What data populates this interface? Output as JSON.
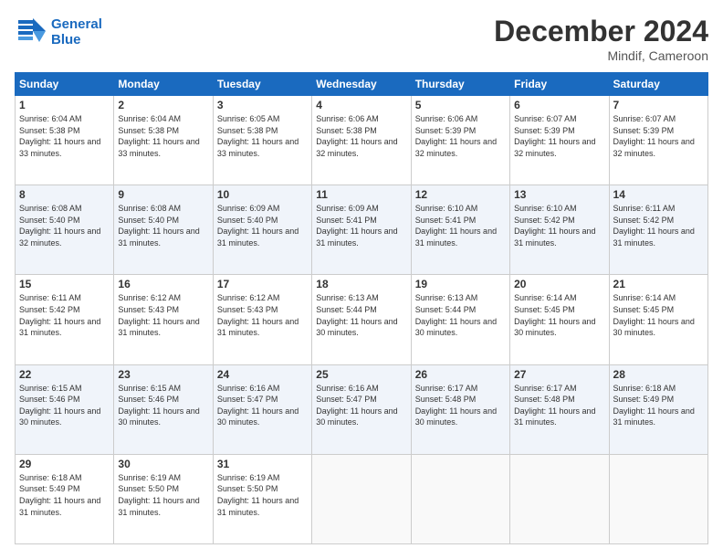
{
  "header": {
    "logo_line1": "General",
    "logo_line2": "Blue",
    "month_title": "December 2024",
    "location": "Mindif, Cameroon"
  },
  "weekdays": [
    "Sunday",
    "Monday",
    "Tuesday",
    "Wednesday",
    "Thursday",
    "Friday",
    "Saturday"
  ],
  "weeks": [
    [
      {
        "day": "1",
        "sunrise": "6:04 AM",
        "sunset": "5:38 PM",
        "daylight": "11 hours and 33 minutes."
      },
      {
        "day": "2",
        "sunrise": "6:04 AM",
        "sunset": "5:38 PM",
        "daylight": "11 hours and 33 minutes."
      },
      {
        "day": "3",
        "sunrise": "6:05 AM",
        "sunset": "5:38 PM",
        "daylight": "11 hours and 33 minutes."
      },
      {
        "day": "4",
        "sunrise": "6:06 AM",
        "sunset": "5:38 PM",
        "daylight": "11 hours and 32 minutes."
      },
      {
        "day": "5",
        "sunrise": "6:06 AM",
        "sunset": "5:39 PM",
        "daylight": "11 hours and 32 minutes."
      },
      {
        "day": "6",
        "sunrise": "6:07 AM",
        "sunset": "5:39 PM",
        "daylight": "11 hours and 32 minutes."
      },
      {
        "day": "7",
        "sunrise": "6:07 AM",
        "sunset": "5:39 PM",
        "daylight": "11 hours and 32 minutes."
      }
    ],
    [
      {
        "day": "8",
        "sunrise": "6:08 AM",
        "sunset": "5:40 PM",
        "daylight": "11 hours and 32 minutes."
      },
      {
        "day": "9",
        "sunrise": "6:08 AM",
        "sunset": "5:40 PM",
        "daylight": "11 hours and 31 minutes."
      },
      {
        "day": "10",
        "sunrise": "6:09 AM",
        "sunset": "5:40 PM",
        "daylight": "11 hours and 31 minutes."
      },
      {
        "day": "11",
        "sunrise": "6:09 AM",
        "sunset": "5:41 PM",
        "daylight": "11 hours and 31 minutes."
      },
      {
        "day": "12",
        "sunrise": "6:10 AM",
        "sunset": "5:41 PM",
        "daylight": "11 hours and 31 minutes."
      },
      {
        "day": "13",
        "sunrise": "6:10 AM",
        "sunset": "5:42 PM",
        "daylight": "11 hours and 31 minutes."
      },
      {
        "day": "14",
        "sunrise": "6:11 AM",
        "sunset": "5:42 PM",
        "daylight": "11 hours and 31 minutes."
      }
    ],
    [
      {
        "day": "15",
        "sunrise": "6:11 AM",
        "sunset": "5:42 PM",
        "daylight": "11 hours and 31 minutes."
      },
      {
        "day": "16",
        "sunrise": "6:12 AM",
        "sunset": "5:43 PM",
        "daylight": "11 hours and 31 minutes."
      },
      {
        "day": "17",
        "sunrise": "6:12 AM",
        "sunset": "5:43 PM",
        "daylight": "11 hours and 31 minutes."
      },
      {
        "day": "18",
        "sunrise": "6:13 AM",
        "sunset": "5:44 PM",
        "daylight": "11 hours and 30 minutes."
      },
      {
        "day": "19",
        "sunrise": "6:13 AM",
        "sunset": "5:44 PM",
        "daylight": "11 hours and 30 minutes."
      },
      {
        "day": "20",
        "sunrise": "6:14 AM",
        "sunset": "5:45 PM",
        "daylight": "11 hours and 30 minutes."
      },
      {
        "day": "21",
        "sunrise": "6:14 AM",
        "sunset": "5:45 PM",
        "daylight": "11 hours and 30 minutes."
      }
    ],
    [
      {
        "day": "22",
        "sunrise": "6:15 AM",
        "sunset": "5:46 PM",
        "daylight": "11 hours and 30 minutes."
      },
      {
        "day": "23",
        "sunrise": "6:15 AM",
        "sunset": "5:46 PM",
        "daylight": "11 hours and 30 minutes."
      },
      {
        "day": "24",
        "sunrise": "6:16 AM",
        "sunset": "5:47 PM",
        "daylight": "11 hours and 30 minutes."
      },
      {
        "day": "25",
        "sunrise": "6:16 AM",
        "sunset": "5:47 PM",
        "daylight": "11 hours and 30 minutes."
      },
      {
        "day": "26",
        "sunrise": "6:17 AM",
        "sunset": "5:48 PM",
        "daylight": "11 hours and 30 minutes."
      },
      {
        "day": "27",
        "sunrise": "6:17 AM",
        "sunset": "5:48 PM",
        "daylight": "11 hours and 31 minutes."
      },
      {
        "day": "28",
        "sunrise": "6:18 AM",
        "sunset": "5:49 PM",
        "daylight": "11 hours and 31 minutes."
      }
    ],
    [
      {
        "day": "29",
        "sunrise": "6:18 AM",
        "sunset": "5:49 PM",
        "daylight": "11 hours and 31 minutes."
      },
      {
        "day": "30",
        "sunrise": "6:19 AM",
        "sunset": "5:50 PM",
        "daylight": "11 hours and 31 minutes."
      },
      {
        "day": "31",
        "sunrise": "6:19 AM",
        "sunset": "5:50 PM",
        "daylight": "11 hours and 31 minutes."
      },
      null,
      null,
      null,
      null
    ]
  ]
}
